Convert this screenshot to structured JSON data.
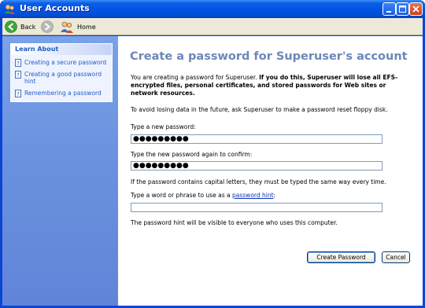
{
  "window": {
    "title": "User Accounts"
  },
  "toolbar": {
    "back_label": "Back",
    "home_label": "Home"
  },
  "sidebar": {
    "heading": "Learn About",
    "items": [
      {
        "label": "Creating a secure password"
      },
      {
        "label": "Creating a good password hint"
      },
      {
        "label": "Remembering a password"
      }
    ]
  },
  "main": {
    "title": "Create a password for Superuser's account",
    "intro_normal": "You are creating a password for Superuser. ",
    "intro_bold": "If you do this, Superuser will lose all EFS-encrypted files, personal certificates, and stored passwords for Web sites or network resources.",
    "floppy_note": "To avoid losing data in the future, ask Superuser to make a password reset floppy disk.",
    "new_password_label": "Type a new password:",
    "new_password_value": "●●●●●●●●●",
    "confirm_label": "Type the new password again to confirm:",
    "confirm_value": "●●●●●●●●●",
    "caps_note": "If the password contains capital letters, they must be typed the same way every time.",
    "hint_label_prefix": "Type a word or phrase to use as a ",
    "hint_link": "password hint",
    "hint_label_suffix": ":",
    "hint_value": "",
    "hint_note": "The password hint will be visible to everyone who uses this computer.",
    "create_button": "Create Password",
    "cancel_button": "Cancel"
  },
  "colors": {
    "title_blue": "#0454e3",
    "sidebar_blue": "#6b93e0",
    "heading": "#6c87b8",
    "link": "#215dc6"
  }
}
